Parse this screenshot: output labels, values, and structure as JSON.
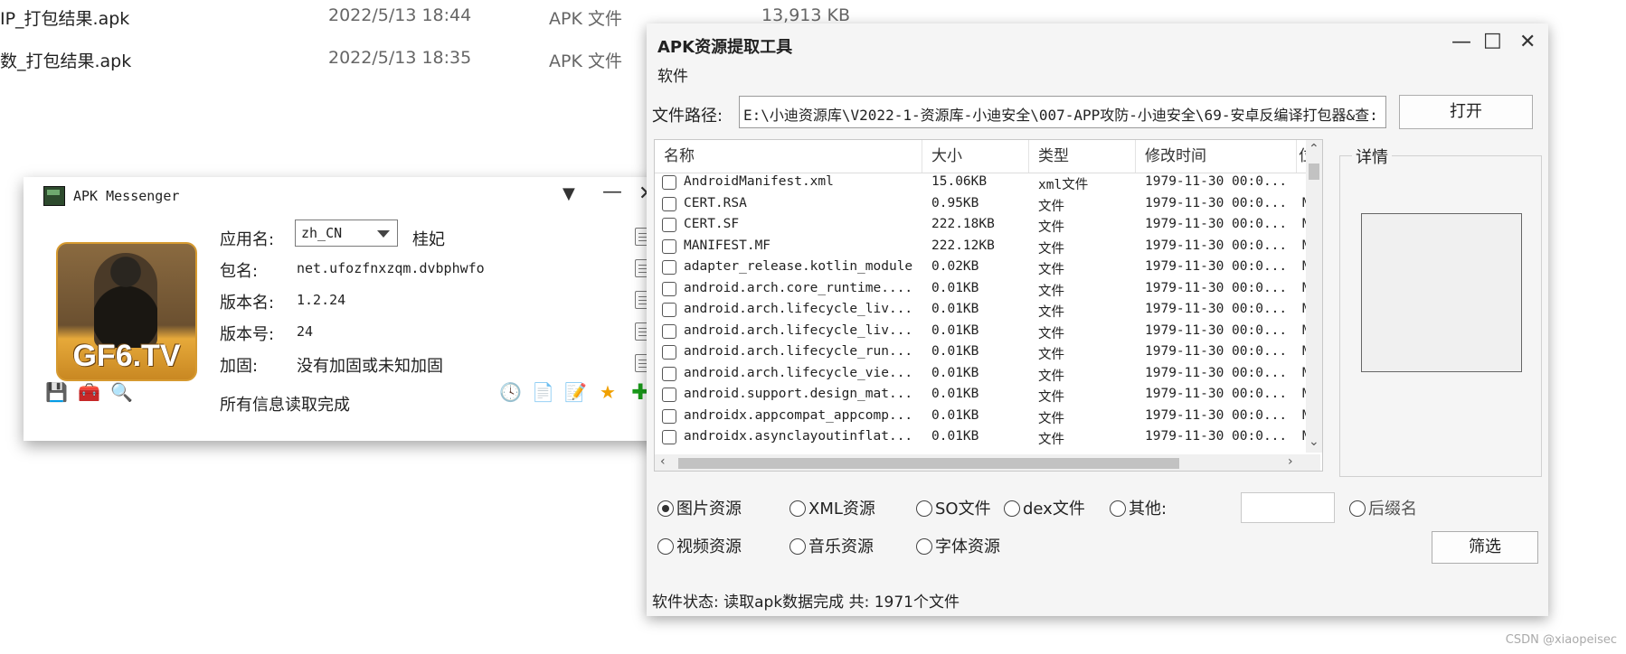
{
  "explorer": {
    "rows": [
      {
        "name": "IP_打包结果.apk",
        "date": "2022/5/13 18:44",
        "type": "APK 文件",
        "size": "13,913 KB"
      },
      {
        "name": "数_打包结果.apk",
        "date": "2022/5/13 18:35",
        "type": "APK 文件",
        "size": ""
      }
    ]
  },
  "messenger": {
    "title": "APK Messenger",
    "poster_text": "GF6.TV",
    "app_name_label": "应用名:",
    "app_name_lang": "zh_CN",
    "app_name_value": "桂妃",
    "package_label": "包名:",
    "package_value": "net.ufozfnxzqm.dvbphwfo",
    "version_name_label": "版本名:",
    "version_name_value": "1.2.24",
    "version_code_label": "版本号:",
    "version_code_value": "24",
    "protection_label": "加固:",
    "protection_value": "没有加固或未知加固",
    "status": "所有信息读取完成"
  },
  "extractor": {
    "title": "APK资源提取工具",
    "menu": "软件",
    "path_label": "文件路径:",
    "path_value": "E:\\小迪资源库\\V2022-1-资源库-小迪安全\\007-APP攻防-小迪安全\\69-安卓反编译打包器&查:",
    "open_button": "打开",
    "columns": [
      "名称",
      "大小",
      "类型",
      "修改时间",
      "位"
    ],
    "rows": [
      [
        "AndroidManifest.xml",
        "15.06KB",
        "xml文件",
        "1979-11-30 00:0...",
        ""
      ],
      [
        "CERT.RSA",
        "0.95KB",
        "文件",
        "1979-11-30 00:0...",
        "MI"
      ],
      [
        "CERT.SF",
        "222.18KB",
        "文件",
        "1979-11-30 00:0...",
        "MI"
      ],
      [
        "MANIFEST.MF",
        "222.12KB",
        "文件",
        "1979-11-30 00:0...",
        "MI"
      ],
      [
        "adapter_release.kotlin_module",
        "0.02KB",
        "文件",
        "1979-11-30 00:0...",
        "MI"
      ],
      [
        "android.arch.core_runtime....",
        "0.01KB",
        "文件",
        "1979-11-30 00:0...",
        "MI"
      ],
      [
        "android.arch.lifecycle_liv...",
        "0.01KB",
        "文件",
        "1979-11-30 00:0...",
        "MI"
      ],
      [
        "android.arch.lifecycle_liv...",
        "0.01KB",
        "文件",
        "1979-11-30 00:0...",
        "MI"
      ],
      [
        "android.arch.lifecycle_run...",
        "0.01KB",
        "文件",
        "1979-11-30 00:0...",
        "MI"
      ],
      [
        "android.arch.lifecycle_vie...",
        "0.01KB",
        "文件",
        "1979-11-30 00:0...",
        "MI"
      ],
      [
        "android.support.design_mat...",
        "0.01KB",
        "文件",
        "1979-11-30 00:0...",
        "MI"
      ],
      [
        "androidx.appcompat_appcomp...",
        "0.01KB",
        "文件",
        "1979-11-30 00:0...",
        "MI"
      ],
      [
        "androidx.asynclayoutinflat...",
        "0.01KB",
        "文件",
        "1979-11-30 00:0...",
        "MI"
      ]
    ],
    "detail_label": "详情",
    "radios_row1": [
      "图片资源",
      "XML资源",
      "SO文件",
      "dex文件",
      "其他:"
    ],
    "suffix_radio": "后缀名",
    "radios_row2": [
      "视频资源",
      "音乐资源",
      "字体资源"
    ],
    "selected_radio": "图片资源",
    "filter_button": "筛选",
    "status": "软件状态: 读取apk数据完成 共: 1971个文件"
  },
  "watermark": "CSDN @xiaopeisec"
}
